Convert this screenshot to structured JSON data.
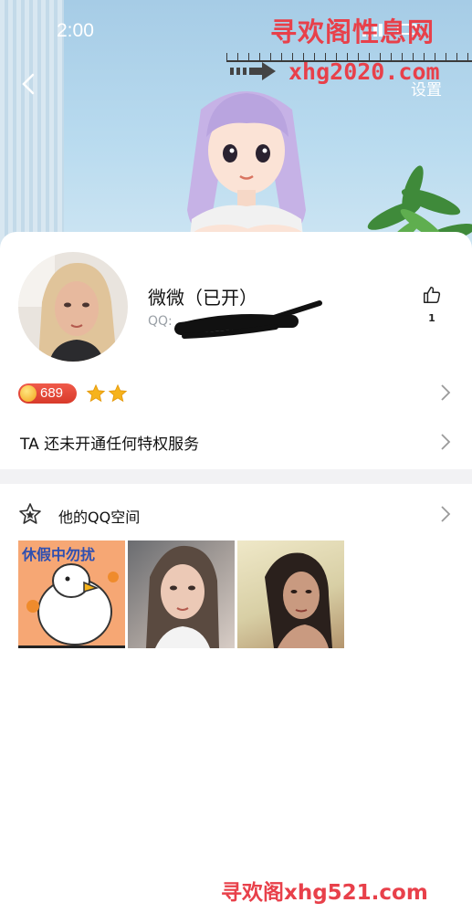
{
  "status_bar": {
    "time": "2:00"
  },
  "header": {
    "settings_label": "设置"
  },
  "watermark": {
    "top_text": "寻欢阁性息网",
    "top_url": "xhg2020.com",
    "bottom_text": "寻欢阁xhg521.com"
  },
  "profile": {
    "nickname": "微微（已开）",
    "qq_label": "QQ:",
    "likes": "1"
  },
  "badges": {
    "coin_count": "689",
    "stars": 2
  },
  "privilege": {
    "text": "TA 还未开通任何特权服务"
  },
  "qzone": {
    "title": "他的QQ空间",
    "photos": [
      {
        "caption": "休假中勿扰"
      },
      {
        "caption": ""
      },
      {
        "caption": ""
      }
    ]
  },
  "colors": {
    "watermark": "#e8404a",
    "banner_sky": "#b9dbef",
    "coin_badge": "#e24a3a",
    "star": "#f6b31c"
  }
}
